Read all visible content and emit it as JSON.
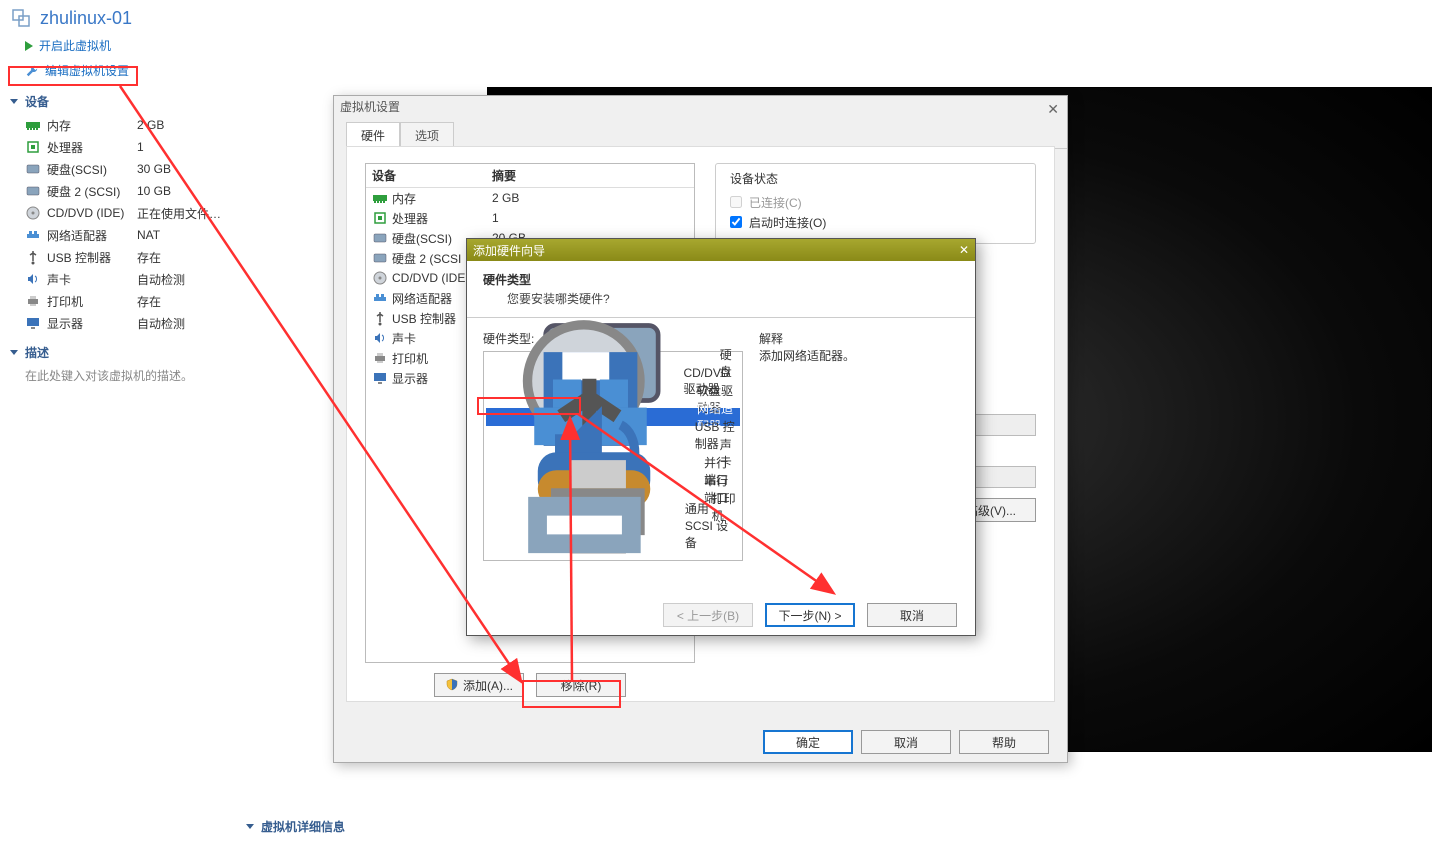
{
  "vm": {
    "name": "zhulinux-01",
    "power_on": "开启此虚拟机",
    "edit_settings": "编辑虚拟机设置"
  },
  "sidebar": {
    "devices_header": "设备",
    "devices": [
      {
        "name": "内存",
        "value": "2 GB",
        "icon": "memory-icon"
      },
      {
        "name": "处理器",
        "value": "1",
        "icon": "cpu-icon"
      },
      {
        "name": "硬盘(SCSI)",
        "value": "30 GB",
        "icon": "disk-icon"
      },
      {
        "name": "硬盘 2 (SCSI)",
        "value": "10 GB",
        "icon": "disk-icon"
      },
      {
        "name": "CD/DVD (IDE)",
        "value": "正在使用文件 E:...",
        "icon": "cd-icon"
      },
      {
        "name": "网络适配器",
        "value": "NAT",
        "icon": "network-icon"
      },
      {
        "name": "USB 控制器",
        "value": "存在",
        "icon": "usb-icon"
      },
      {
        "name": "声卡",
        "value": "自动检测",
        "icon": "sound-icon"
      },
      {
        "name": "打印机",
        "value": "存在",
        "icon": "printer-icon"
      },
      {
        "name": "显示器",
        "value": "自动检测",
        "icon": "display-icon"
      }
    ],
    "desc_header": "描述",
    "desc_placeholder": "在此处键入对该虚拟机的描述。"
  },
  "bottom_section": "虚拟机详细信息",
  "settings": {
    "title": "虚拟机设置",
    "tabs": [
      "硬件",
      "选项"
    ],
    "col_device": "设备",
    "col_summary": "摘要",
    "devices": [
      {
        "name": "内存",
        "summary": "2 GB",
        "icon": "memory-icon"
      },
      {
        "name": "处理器",
        "summary": "1",
        "icon": "cpu-icon"
      },
      {
        "name": "硬盘(SCSI)",
        "summary": "20 GB",
        "icon": "disk-icon"
      },
      {
        "name": "硬盘 2 (SCSI",
        "summary": "",
        "icon": "disk-icon"
      },
      {
        "name": "CD/DVD (IDE",
        "summary": "",
        "icon": "cd-icon"
      },
      {
        "name": "网络适配器",
        "summary": "",
        "icon": "network-icon"
      },
      {
        "name": "USB 控制器",
        "summary": "",
        "icon": "usb-icon"
      },
      {
        "name": "声卡",
        "summary": "",
        "icon": "sound-icon"
      },
      {
        "name": "打印机",
        "summary": "",
        "icon": "printer-icon"
      },
      {
        "name": "显示器",
        "summary": "",
        "icon": "display-icon"
      }
    ],
    "add": "添加(A)...",
    "remove": "移除(R)",
    "state_header": "设备状态",
    "connected": "已连接(C)",
    "connect_at_power": "启动时连接(O)",
    "advanced": "高级(V)...",
    "ok": "确定",
    "cancel": "取消",
    "help": "帮助"
  },
  "wizard": {
    "title": "添加硬件向导",
    "heading": "硬件类型",
    "subheading": "您要安装哪类硬件?",
    "list_label": "硬件类型:",
    "explain_label": "解释",
    "explain_text": "添加网络适配器。",
    "hw": [
      {
        "name": "硬盘",
        "icon": "disk-icon"
      },
      {
        "name": "CD/DVD 驱动器",
        "icon": "cd-icon"
      },
      {
        "name": "软盘驱动器",
        "icon": "floppy-icon"
      },
      {
        "name": "网络适配器",
        "icon": "network-icon",
        "selected": true
      },
      {
        "name": "USB 控制器",
        "icon": "usb-icon"
      },
      {
        "name": "声卡",
        "icon": "sound-icon"
      },
      {
        "name": "并行端口",
        "icon": "parallel-icon"
      },
      {
        "name": "串行端口",
        "icon": "serial-icon"
      },
      {
        "name": "打印机",
        "icon": "printer-icon"
      },
      {
        "name": "通用 SCSI 设备",
        "icon": "scsi-icon"
      }
    ],
    "back": "< 上一步(B)",
    "next": "下一步(N) >",
    "cancel": "取消"
  }
}
